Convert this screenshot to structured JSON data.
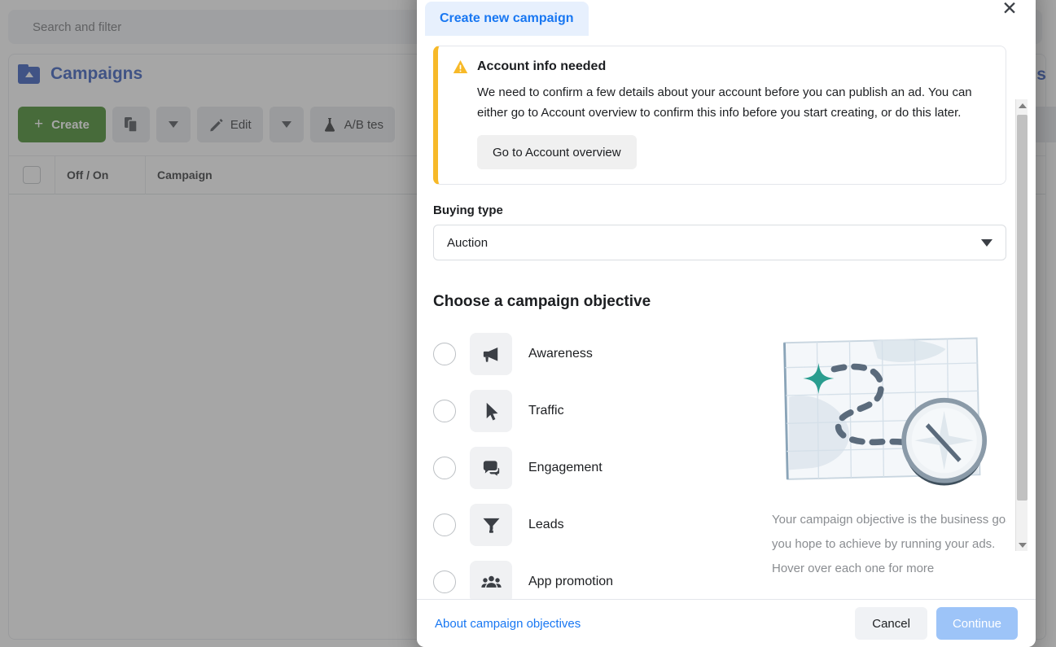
{
  "background": {
    "search_placeholder": "Search and filter",
    "campaigns_title": "Campaigns",
    "ads_label": "ds",
    "toolbar": {
      "create_label": "Create",
      "create_plus": "+",
      "edit_label": "Edit",
      "ab_test_label": "A/B tes"
    },
    "table_headers": {
      "off_on": "Off / On",
      "campaign": "Campaign"
    }
  },
  "modal": {
    "tab_label": "Create new campaign",
    "close_icon": "✕",
    "alert": {
      "title": "Account info needed",
      "body": "We need to confirm a few details about your account before you can publish an ad. You can either go to Account overview to confirm this info before you start creating, or do this later.",
      "button_label": "Go to Account overview",
      "accent_color": "#f7b928"
    },
    "buying_type": {
      "label": "Buying type",
      "value": "Auction"
    },
    "objective_section": {
      "title": "Choose a campaign objective",
      "options": [
        {
          "label": "Awareness",
          "icon": "megaphone-icon",
          "selected": false
        },
        {
          "label": "Traffic",
          "icon": "cursor-arrow-icon",
          "selected": false
        },
        {
          "label": "Engagement",
          "icon": "speech-bubbles-icon",
          "selected": false
        },
        {
          "label": "Leads",
          "icon": "funnel-icon",
          "selected": false
        },
        {
          "label": "App promotion",
          "icon": "people-group-icon",
          "selected": false
        }
      ],
      "description": "Your campaign objective is the business goal you hope to achieve by running your ads. Hover over each one for more",
      "illustration": "map-compass-illustration"
    },
    "footer": {
      "about_link": "About campaign objectives",
      "cancel_label": "Cancel",
      "continue_label": "Continue",
      "continue_disabled": true
    },
    "colors": {
      "tab_text": "#1877f2",
      "tab_bg": "#e7f0fd",
      "continue_disabled_bg": "#9dc4f8",
      "warning": "#f7b928",
      "brand_blue": "#1d48b6",
      "create_green": "#2e7d11"
    }
  }
}
